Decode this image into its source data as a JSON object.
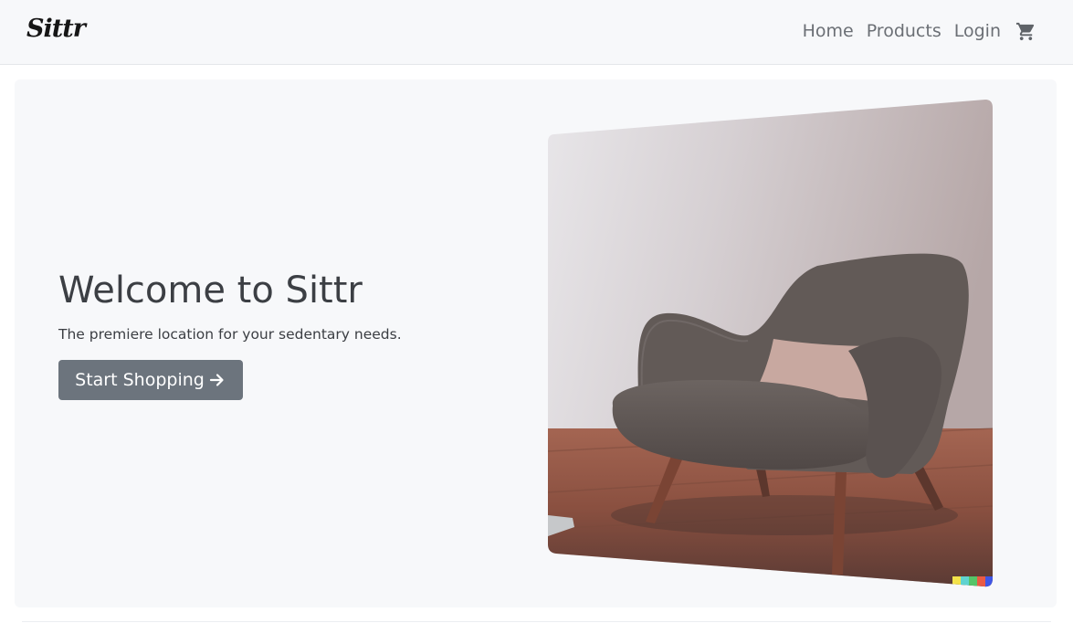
{
  "navbar": {
    "brand": "Sittr",
    "links": [
      {
        "label": "Home"
      },
      {
        "label": "Products"
      },
      {
        "label": "Login"
      }
    ],
    "cart_icon": "shopping-cart-icon"
  },
  "hero": {
    "title": "Welcome to Sittr",
    "subtitle": "The premiere location for your sedentary needs.",
    "cta_label": "Start Shopping",
    "cta_icon": "arrow-right-icon",
    "image": "armchair-photo"
  },
  "colors": {
    "navbar_bg": "#f7f8fa",
    "hero_bg": "#f7f8fa",
    "button_bg": "#6c747d",
    "text": "#3c3f44",
    "nav_link": "#6b6f75"
  }
}
